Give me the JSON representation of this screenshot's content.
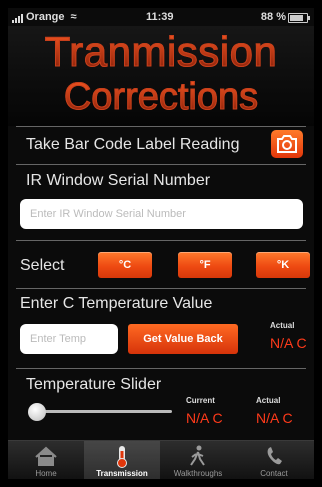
{
  "status_bar": {
    "carrier": "Orange",
    "time": "11:39",
    "battery": "88 %"
  },
  "header": {
    "title_line1": "Tranmission",
    "title_line2": "Corrections"
  },
  "barcode": {
    "label": "Take Bar Code Label Reading"
  },
  "ir_window": {
    "label": "IR Window Serial Number",
    "placeholder": "Enter IR Window Serial Number",
    "value": ""
  },
  "units": {
    "label": "Select",
    "buttons": [
      "°C",
      "°F",
      "°K"
    ]
  },
  "temperature": {
    "label": "Enter C Temperature Value",
    "placeholder": "Enter Temp",
    "button": "Get Value Back",
    "actual_label": "Actual",
    "actual_value": "N/A  C"
  },
  "slider": {
    "label": "Temperature Slider",
    "value": 0,
    "current_label": "Current",
    "current_value": "N/A  C",
    "actual_label": "Actual",
    "actual_value": "N/A  C"
  },
  "tabs": [
    {
      "label": "Home",
      "icon": "home-icon",
      "active": false
    },
    {
      "label": "Transmission",
      "icon": "thermometer-icon",
      "active": true
    },
    {
      "label": "Walkthroughs",
      "icon": "walking-person-icon",
      "active": false
    },
    {
      "label": "Contact",
      "icon": "phone-icon",
      "active": false
    }
  ],
  "colors": {
    "accent": "#f0501a",
    "value_red": "#ff3a1a",
    "background": "#0b0b0b"
  }
}
